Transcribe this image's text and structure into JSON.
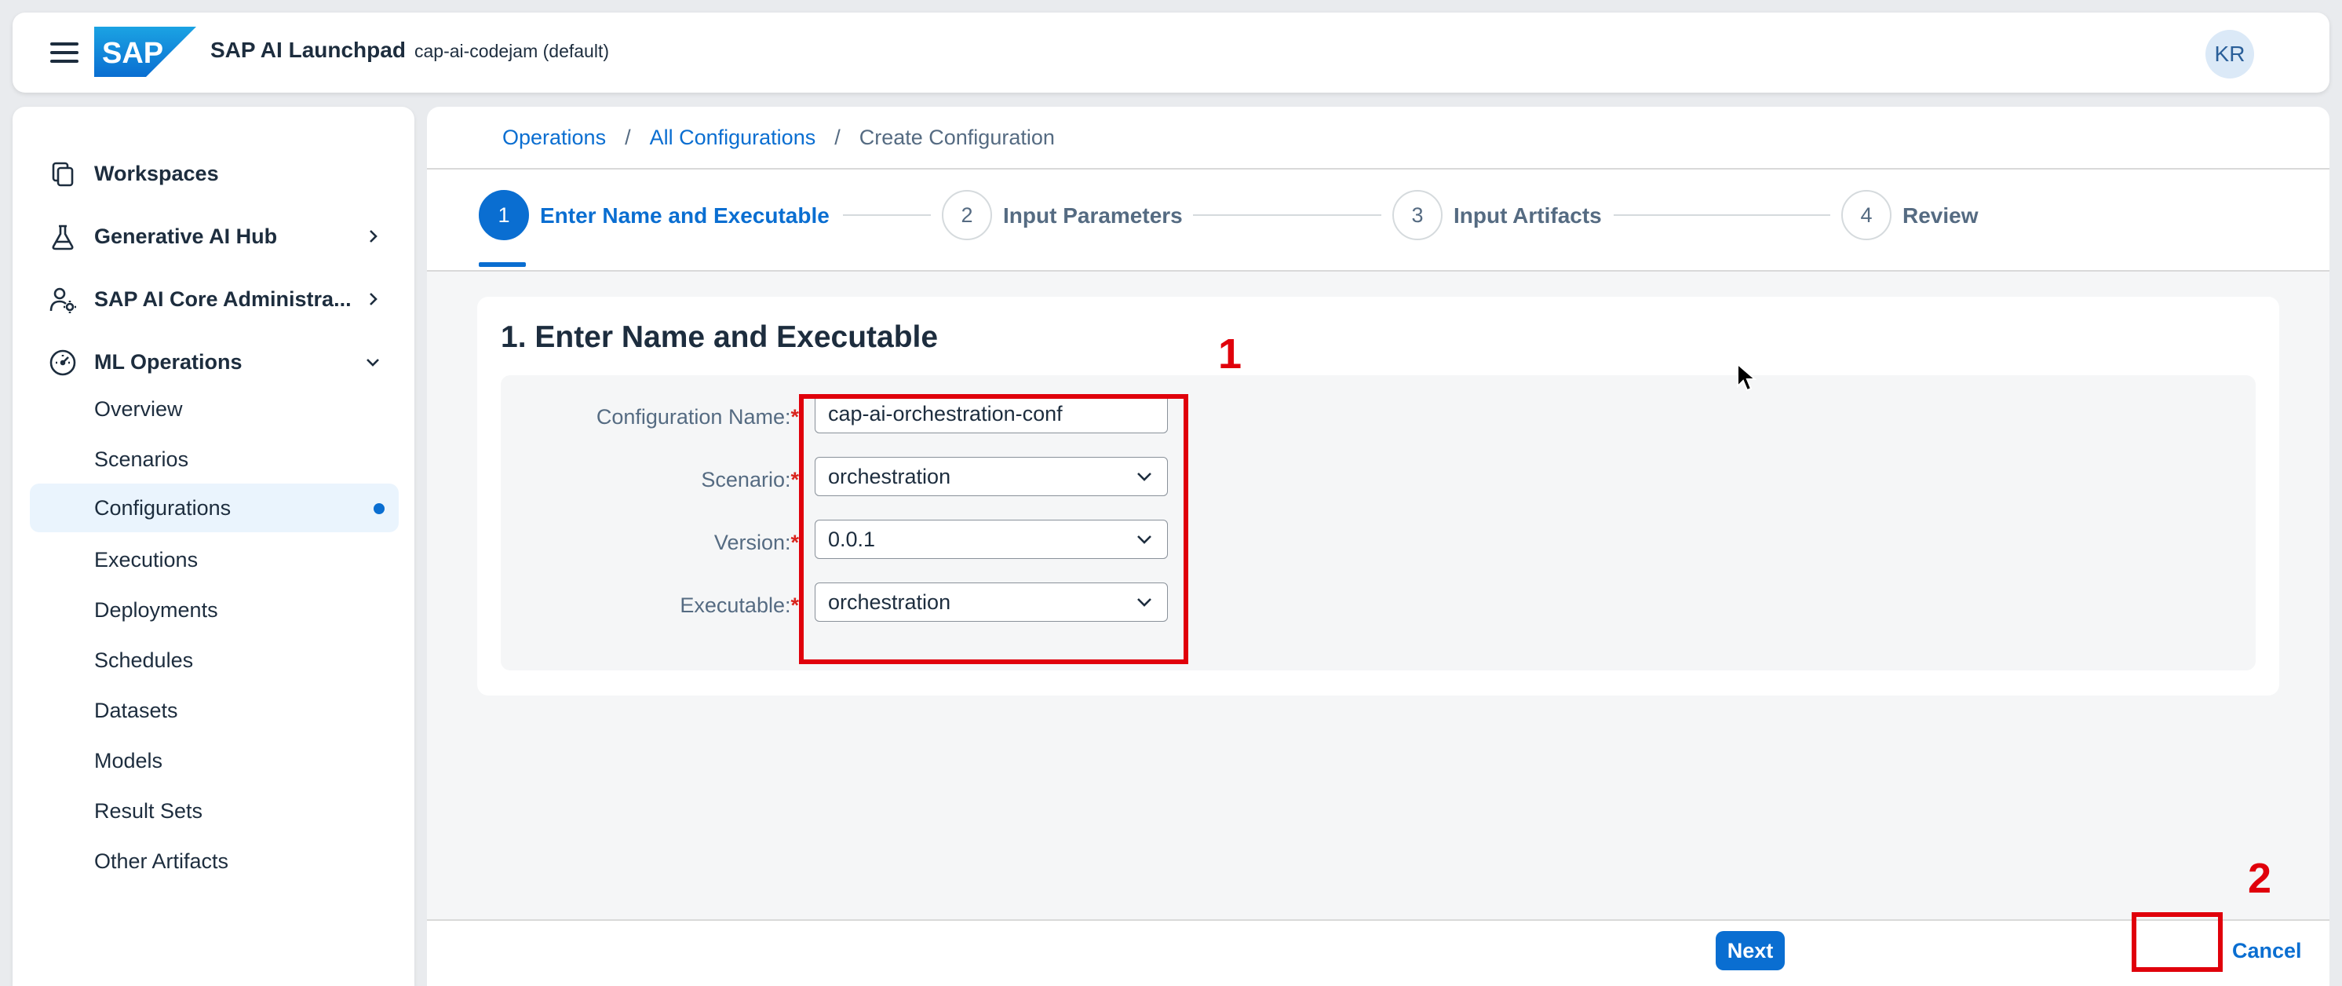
{
  "shell": {
    "title": "SAP AI Launchpad",
    "tenant": "cap-ai-codejam (default)",
    "logo_text": "SAP",
    "avatar_initials": "KR"
  },
  "sidebar": {
    "items": [
      {
        "label": "Workspaces",
        "icon": "workspaces-icon"
      },
      {
        "label": "Generative AI Hub",
        "icon": "flask-icon"
      },
      {
        "label": "SAP AI Core Administra...",
        "icon": "user-settings-icon"
      },
      {
        "label": "ML Operations",
        "icon": "dashboard-gauge-icon"
      }
    ],
    "ml_operations_children": [
      "Overview",
      "Scenarios",
      "Configurations",
      "Executions",
      "Deployments",
      "Schedules",
      "Datasets",
      "Models",
      "Result Sets",
      "Other Artifacts"
    ],
    "active_child": "Configurations"
  },
  "breadcrumb": {
    "items": [
      "Operations",
      "All Configurations"
    ],
    "separator": "/",
    "current": "Create Configuration"
  },
  "wizard": {
    "steps": [
      {
        "number": "1",
        "label": "Enter Name and Executable"
      },
      {
        "number": "2",
        "label": "Input Parameters"
      },
      {
        "number": "3",
        "label": "Input Artifacts"
      },
      {
        "number": "4",
        "label": "Review"
      }
    ],
    "active_step": 1
  },
  "form": {
    "title": "1. Enter Name and Executable",
    "required_mark": "*",
    "fields": {
      "name": {
        "label": "Configuration Name:",
        "value": "cap-ai-orchestration-conf"
      },
      "scenario": {
        "label": "Scenario:",
        "value": "orchestration"
      },
      "version": {
        "label": "Version:",
        "value": "0.0.1"
      },
      "executable": {
        "label": "Executable:",
        "value": "orchestration"
      }
    }
  },
  "footer": {
    "next_label": "Next",
    "cancel_label": "Cancel"
  },
  "annotations": {
    "marker1": "1",
    "marker2": "2",
    "color": "#e0000b"
  },
  "colors": {
    "accent": "#0a6ed1",
    "text": "#1d2d3e",
    "muted": "#556b82",
    "required": "#d9251e",
    "active_nav_bg": "#eaf4fd"
  }
}
